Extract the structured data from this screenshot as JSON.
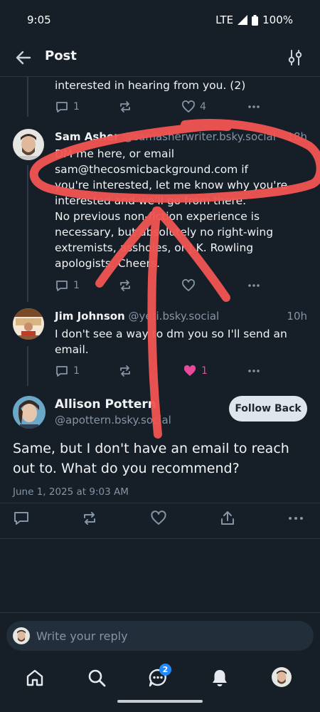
{
  "status": {
    "time": "9:05",
    "network": "LTE",
    "battery": "100%"
  },
  "header": {
    "title": "Post"
  },
  "thread": {
    "prev_tail": {
      "text": "interested in hearing from you. (2)",
      "replies": "1",
      "likes": "4"
    },
    "posts": [
      {
        "name": "Sam Asher",
        "handle": "@samasherwriter.bsky.social",
        "time": "18h",
        "lines": [
          "DM me here, or email",
          "sam@thecosmicbackground.com if",
          "you're interested, let me know why you're",
          "interested and we'll go from there.",
          "No previous non-fiction experience is",
          "necessary, but absolutely no right-wing",
          "extremists, assholes, or J.K. Rowling",
          "apologists. Cheers."
        ],
        "replies": "1",
        "likes": ""
      },
      {
        "name": "Jim Johnson",
        "handle": "@yeti.bsky.social",
        "time": "10h",
        "lines": [
          "I don't see a way to dm you so I'll send an",
          "email."
        ],
        "replies": "1",
        "likes": "1"
      }
    ]
  },
  "main_post": {
    "name": "Allison Pottern",
    "handle": "@apottern.bsky.social",
    "follow_label": "Follow Back",
    "text": "Same, but I don't have an email to reach out to. What do you recommend?",
    "date": "June 1, 2025 at 9:03 AM"
  },
  "reply_bar": {
    "placeholder": "Write your reply"
  },
  "nav": {
    "chat_badge": "2"
  },
  "colors": {
    "background": "#161e27",
    "like_active": "#ec4899",
    "annotation": "#f25552",
    "accent": "#208bfe"
  },
  "icons": [
    "back-arrow-icon",
    "filter-icon",
    "reply-icon",
    "repost-icon",
    "heart-icon",
    "more-icon",
    "share-icon",
    "home-icon",
    "search-icon",
    "chat-icon",
    "bell-icon"
  ]
}
